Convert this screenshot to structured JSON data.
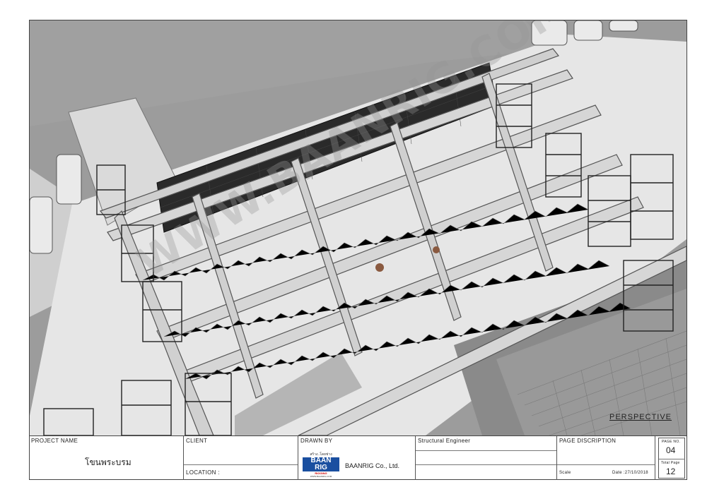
{
  "drawing": {
    "view_label": "PERSPECTIVE",
    "watermark": "WWW.BAANRIG.COM"
  },
  "title_block": {
    "project_name_label": "PROJECT NAME",
    "project_name_value": "โขนพระบรม",
    "client_label": "CLIENT",
    "location_label": "LOCATION :",
    "drawn_by_label": "DRAWN BY",
    "logo": {
      "tagline": "สร้าง..โดยช่าง",
      "brand_line1": "BAAN",
      "brand_line2": "RIG",
      "small_text": "RIGGING",
      "url": "WWW.BAANRIG.COM"
    },
    "company": "BAANRIG Co., Ltd.",
    "engineer_label": "Structural Engineer",
    "page_description_label": "PAGE DISCRIPTION",
    "scale_label": "Scale",
    "date_label": "Date :27/10/2018",
    "page_no_label": "PAGE NO.",
    "page_no_value": "04",
    "total_page_label": "Total Page",
    "total_page_value": "12"
  }
}
